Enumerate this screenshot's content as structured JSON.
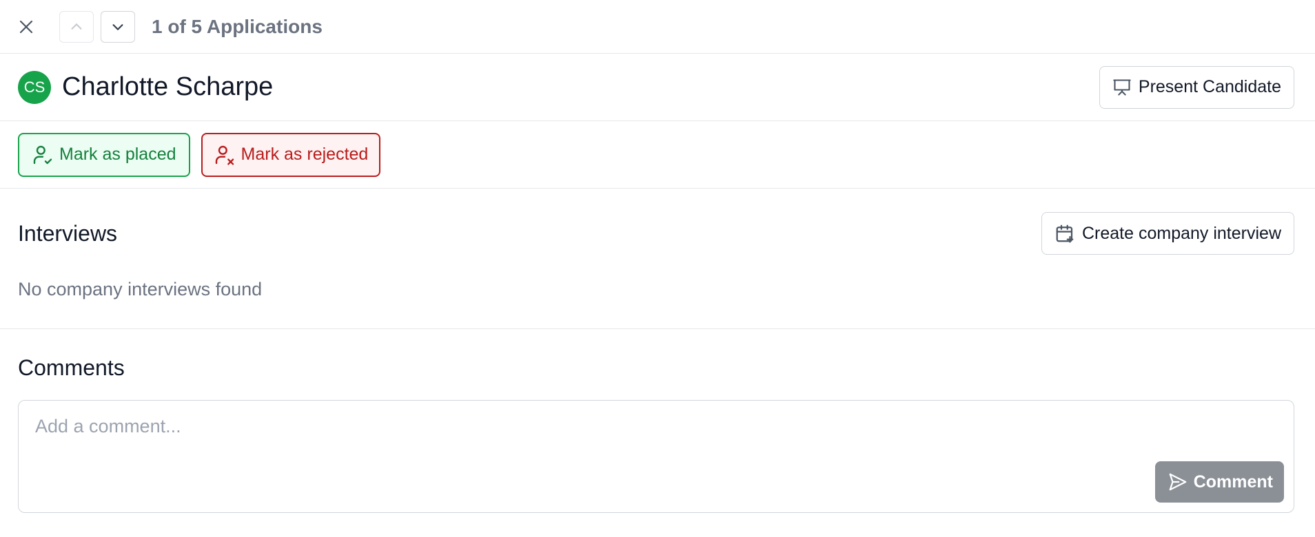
{
  "nav": {
    "counter": "1 of 5 Applications",
    "icons": {
      "close": "close-icon",
      "prev": "chevron-up-icon",
      "next": "chevron-down-icon"
    }
  },
  "candidate": {
    "initials": "CS",
    "name": "Charlotte Scharpe",
    "avatar_color": "#16a34a",
    "present_label": "Present Candidate"
  },
  "actions": {
    "placed_label": "Mark as placed",
    "rejected_label": "Mark as rejected",
    "placed_color": "#16a34a",
    "rejected_color": "#b91c1c"
  },
  "interviews": {
    "title": "Interviews",
    "create_label": "Create company interview",
    "empty_text": "No company interviews found"
  },
  "comments": {
    "title": "Comments",
    "placeholder": "Add a comment...",
    "submit_label": "Comment"
  }
}
